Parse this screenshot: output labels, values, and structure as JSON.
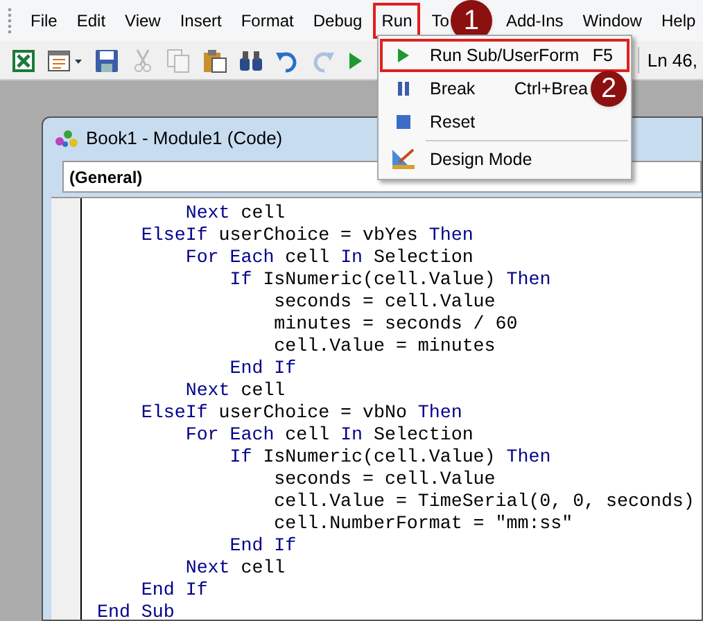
{
  "menu_bar": [
    {
      "label": "File",
      "selected": false
    },
    {
      "label": "Edit",
      "selected": false
    },
    {
      "label": "View",
      "selected": false
    },
    {
      "label": "Insert",
      "selected": false
    },
    {
      "label": "Format",
      "selected": false
    },
    {
      "label": "Debug",
      "selected": false
    },
    {
      "label": "Run",
      "selected": true
    },
    {
      "label": "To",
      "selected": false,
      "callout": "1"
    },
    {
      "label": "Add-Ins",
      "selected": false
    },
    {
      "label": "Window",
      "selected": false
    },
    {
      "label": "Help",
      "selected": false
    }
  ],
  "toolbar": {
    "buttons": [
      {
        "kind": "excel",
        "disabled": false
      },
      {
        "kind": "form",
        "disabled": false
      },
      {
        "kind": "save",
        "disabled": false
      },
      {
        "kind": "cut",
        "disabled": true
      },
      {
        "kind": "copy",
        "disabled": true
      },
      {
        "kind": "paste",
        "disabled": false
      },
      {
        "kind": "find",
        "disabled": false
      },
      {
        "kind": "undo",
        "disabled": false
      },
      {
        "kind": "redo",
        "disabled": true
      },
      {
        "kind": "run",
        "disabled": false
      }
    ],
    "position": "Ln 46,"
  },
  "run_menu": {
    "items": [
      {
        "kind": "run",
        "label": "Run Sub/UserForm",
        "shortcut": "F5",
        "outlined": true
      },
      {
        "kind": "break",
        "label": "Break",
        "shortcut": "Ctrl+Brea",
        "outlined": false,
        "callout": "2"
      },
      {
        "kind": "reset",
        "label": "Reset",
        "outlined": false
      },
      {
        "kind": "separator"
      },
      {
        "kind": "design",
        "label": "Design Mode",
        "outlined": false
      }
    ]
  },
  "code_window": {
    "title": "Book1 - Module1 (Code)",
    "object_dropdown": "(General)",
    "lines": [
      [
        {
          "t": "        Next",
          "kind": "keyword"
        },
        {
          "t": " cell"
        }
      ],
      [
        {
          "t": "    ElseIf",
          "kind": "keyword"
        },
        {
          "t": " userChoice = vbYes "
        },
        {
          "t": "Then",
          "kind": "keyword"
        }
      ],
      [
        {
          "t": "        For Each",
          "kind": "keyword"
        },
        {
          "t": " cell "
        },
        {
          "t": "In",
          "kind": "keyword"
        },
        {
          "t": " Selection"
        }
      ],
      [
        {
          "t": "            If",
          "kind": "keyword"
        },
        {
          "t": " IsNumeric(cell.Value) "
        },
        {
          "t": "Then",
          "kind": "keyword"
        }
      ],
      [
        {
          "t": "                seconds = cell.Value"
        }
      ],
      [
        {
          "t": "                minutes = seconds / 60"
        }
      ],
      [
        {
          "t": "                cell.Value = minutes"
        }
      ],
      [
        {
          "t": "            End If",
          "kind": "keyword"
        }
      ],
      [
        {
          "t": "        Next",
          "kind": "keyword"
        },
        {
          "t": " cell"
        }
      ],
      [
        {
          "t": "    ElseIf",
          "kind": "keyword"
        },
        {
          "t": " userChoice = vbNo "
        },
        {
          "t": "Then",
          "kind": "keyword"
        }
      ],
      [
        {
          "t": "        For Each",
          "kind": "keyword"
        },
        {
          "t": " cell "
        },
        {
          "t": "In",
          "kind": "keyword"
        },
        {
          "t": " Selection"
        }
      ],
      [
        {
          "t": "            If",
          "kind": "keyword"
        },
        {
          "t": " IsNumeric(cell.Value) "
        },
        {
          "t": "Then",
          "kind": "keyword"
        }
      ],
      [
        {
          "t": "                seconds = cell.Value"
        }
      ],
      [
        {
          "t": "                cell.Value = TimeSerial(0, 0, seconds)"
        }
      ],
      [
        {
          "t": "                cell.NumberFormat = \"mm:ss\""
        }
      ],
      [
        {
          "t": "            End If",
          "kind": "keyword"
        }
      ],
      [
        {
          "t": "        Next",
          "kind": "keyword"
        },
        {
          "t": " cell"
        }
      ],
      [
        {
          "t": "    End If",
          "kind": "keyword"
        }
      ],
      [
        {
          "t": "End Sub",
          "kind": "keyword"
        }
      ]
    ]
  }
}
